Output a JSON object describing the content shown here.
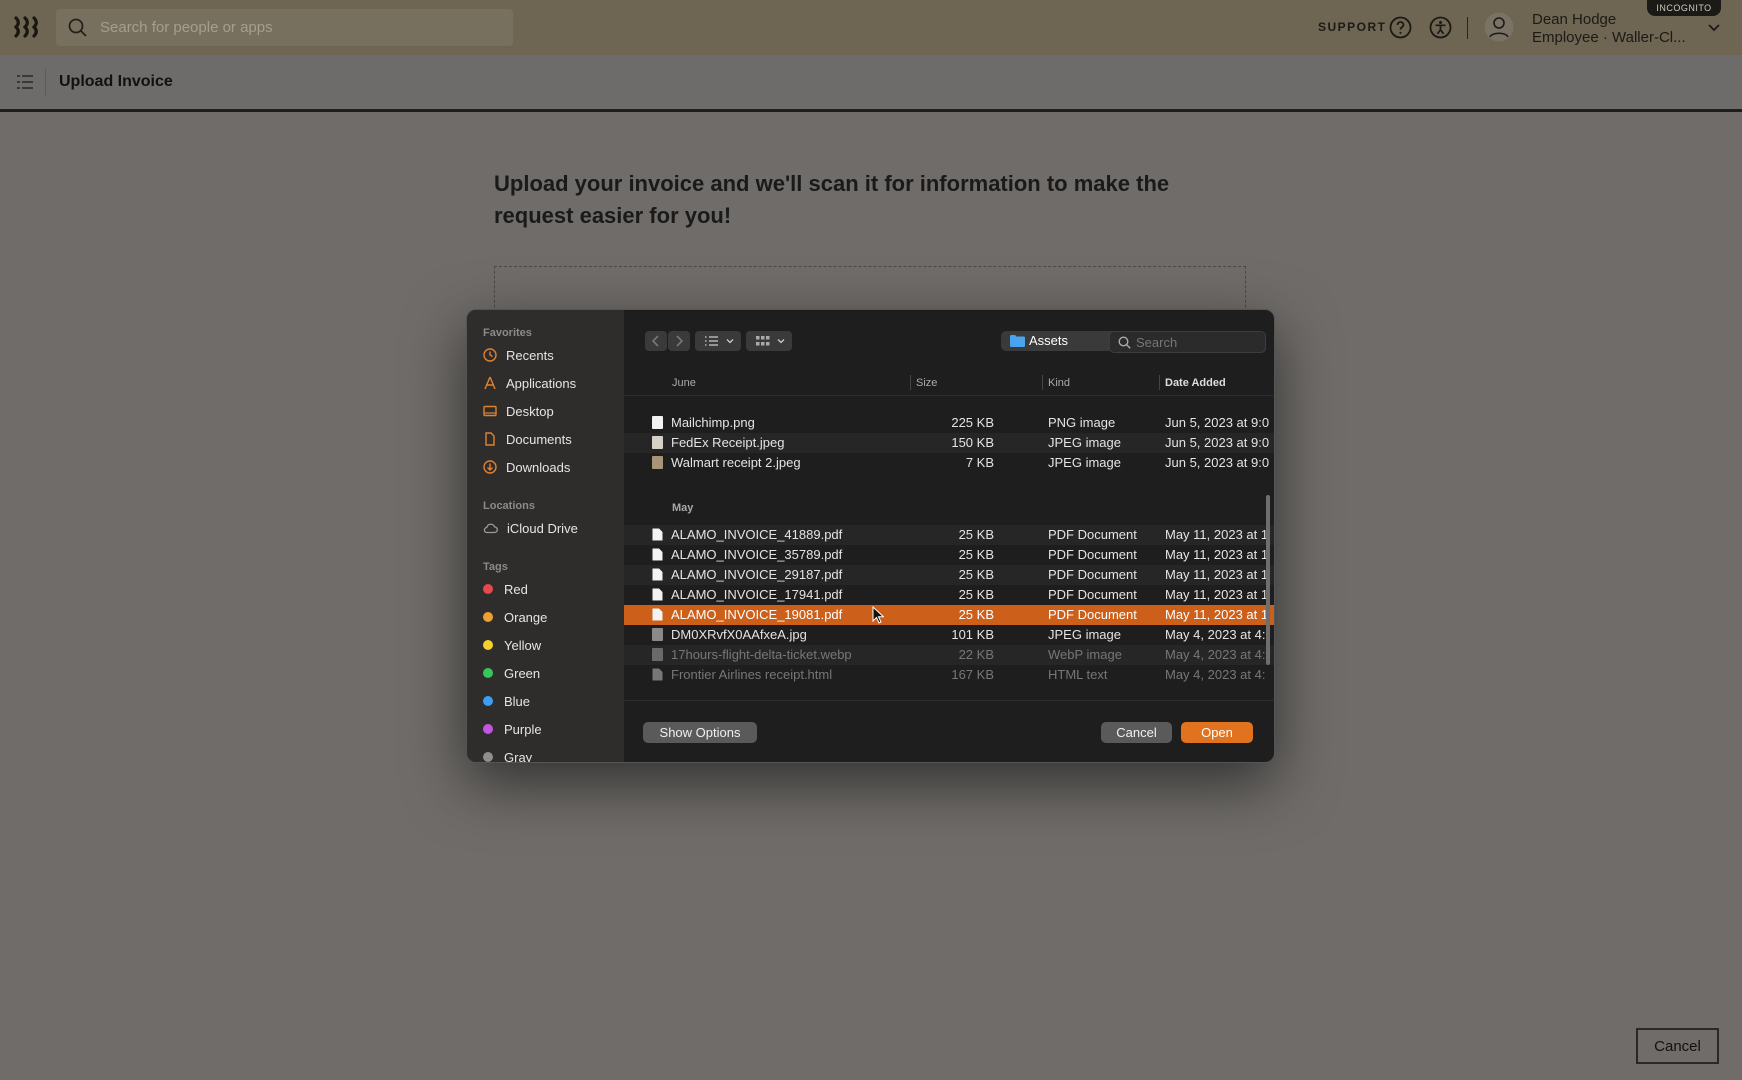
{
  "topbar": {
    "search_placeholder": "Search for people or apps",
    "support_label": "SUPPORT",
    "user_name": "Dean Hodge",
    "user_role": "Employee · Waller-Cl...",
    "incognito_badge": "INCOGNITO"
  },
  "subheader": {
    "title": "Upload Invoice"
  },
  "main": {
    "headline": "Upload your invoice and we'll scan it for information to make the request easier for you!",
    "cancel_label": "Cancel"
  },
  "dialog": {
    "sidebar": {
      "favorites_label": "Favorites",
      "favorites": [
        {
          "label": "Recents",
          "icon": "clock-icon"
        },
        {
          "label": "Applications",
          "icon": "applications-icon"
        },
        {
          "label": "Desktop",
          "icon": "desktop-icon"
        },
        {
          "label": "Documents",
          "icon": "document-icon"
        },
        {
          "label": "Downloads",
          "icon": "download-icon"
        }
      ],
      "locations_label": "Locations",
      "locations": [
        {
          "label": "iCloud Drive",
          "icon": "cloud-icon"
        }
      ],
      "tags_label": "Tags",
      "tags": [
        {
          "label": "Red",
          "color": "#e5484d"
        },
        {
          "label": "Orange",
          "color": "#f0a030"
        },
        {
          "label": "Yellow",
          "color": "#f4d12b"
        },
        {
          "label": "Green",
          "color": "#35c759"
        },
        {
          "label": "Blue",
          "color": "#3a9ff5"
        },
        {
          "label": "Purple",
          "color": "#c454e0"
        },
        {
          "label": "Gray",
          "color": "#8e8e8e"
        }
      ]
    },
    "folder": "Assets",
    "search_placeholder": "Search",
    "columns": {
      "name": "June",
      "size": "Size",
      "kind": "Kind",
      "date": "Date Added"
    },
    "groups": [
      {
        "label": "June",
        "files": [
          {
            "name": "Mailchimp.png",
            "size": "225 KB",
            "kind": "PNG image",
            "date": "Jun 5, 2023 at 9:0"
          },
          {
            "name": "FedEx Receipt.jpeg",
            "size": "150 KB",
            "kind": "JPEG image",
            "date": "Jun 5, 2023 at 9:0"
          },
          {
            "name": "Walmart receipt 2.jpeg",
            "size": "7 KB",
            "kind": "JPEG image",
            "date": "Jun 5, 2023 at 9:0"
          }
        ]
      },
      {
        "label": "May",
        "files": [
          {
            "name": "ALAMO_INVOICE_41889.pdf",
            "size": "25 KB",
            "kind": "PDF Document",
            "date": "May 11, 2023 at 1"
          },
          {
            "name": "ALAMO_INVOICE_35789.pdf",
            "size": "25 KB",
            "kind": "PDF Document",
            "date": "May 11, 2023 at 1"
          },
          {
            "name": "ALAMO_INVOICE_29187.pdf",
            "size": "25 KB",
            "kind": "PDF Document",
            "date": "May 11, 2023 at 1"
          },
          {
            "name": "ALAMO_INVOICE_17941.pdf",
            "size": "25 KB",
            "kind": "PDF Document",
            "date": "May 11, 2023 at 1"
          },
          {
            "name": "ALAMO_INVOICE_19081.pdf",
            "size": "25 KB",
            "kind": "PDF Document",
            "date": "May 11, 2023 at 1",
            "selected": true
          },
          {
            "name": "DM0XRvfX0AAfxeA.jpg",
            "size": "101 KB",
            "kind": "JPEG image",
            "date": "May 4, 2023 at 4:"
          },
          {
            "name": "17hours-flight-delta-ticket.webp",
            "size": "22 KB",
            "kind": "WebP image",
            "date": "May 4, 2023 at 4:",
            "dimmed": true
          },
          {
            "name": "Frontier Airlines receipt.html",
            "size": "167 KB",
            "kind": "HTML text",
            "date": "May 4, 2023 at 4:",
            "dimmed": true
          }
        ]
      }
    ],
    "show_options_label": "Show Options",
    "cancel_label": "Cancel",
    "open_label": "Open"
  },
  "colors": {
    "accent": "#e2731e",
    "selected_row": "#cc5f1a"
  }
}
